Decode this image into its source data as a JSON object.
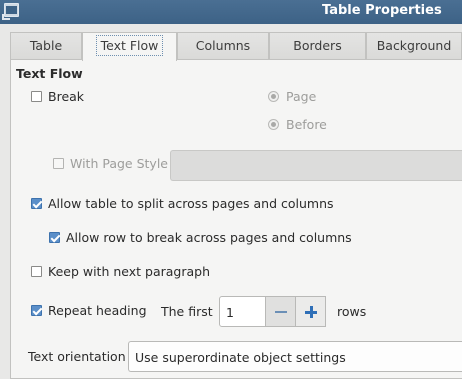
{
  "window": {
    "title": "Table Properties"
  },
  "tabs": [
    {
      "label": "Table",
      "active": false
    },
    {
      "label": "Text Flow",
      "active": true
    },
    {
      "label": "Columns",
      "active": false
    },
    {
      "label": "Borders",
      "active": false
    },
    {
      "label": "Background",
      "active": false
    }
  ],
  "text_flow": {
    "heading": "Text Flow",
    "break": {
      "label": "Break",
      "checked": false
    },
    "break_type": {
      "page_label": "Page",
      "page_selected": true
    },
    "break_position": {
      "before_label": "Before",
      "before_selected": true
    },
    "with_page_style": {
      "label": "With Page Style",
      "checked": false,
      "value": ""
    },
    "allow_split": {
      "label": "Allow table to split across pages and columns",
      "checked": true
    },
    "allow_row_break": {
      "label": "Allow row to break across pages and columns",
      "checked": true
    },
    "keep_with_next": {
      "label": "Keep with next paragraph",
      "checked": false
    },
    "repeat_heading": {
      "label": "Repeat heading",
      "checked": true,
      "first_label": "The first",
      "rows_value": "1",
      "rows_label": "rows"
    },
    "text_orientation": {
      "label": "Text orientation",
      "value": "Use superordinate object settings"
    }
  },
  "colors": {
    "accent": "#5b8fc9",
    "titlebar": "#4a6f93"
  }
}
